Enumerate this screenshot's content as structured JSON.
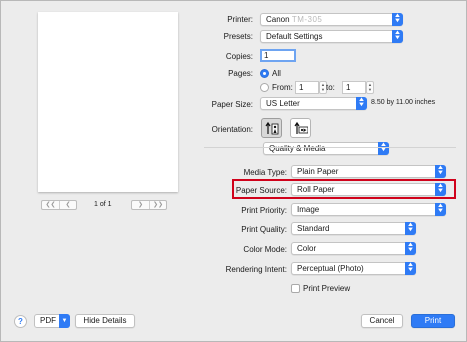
{
  "pager": {
    "text": "1 of 1",
    "first_icon": "double-left-arrow-icon",
    "prev_icon": "left-arrow-icon",
    "next_icon": "right-arrow-icon",
    "last_icon": "double-right-arrow-icon"
  },
  "printer": {
    "label": "Printer:",
    "value_prefix": "Canon",
    "value_model": "TM-305"
  },
  "presets": {
    "label": "Presets:",
    "value": "Default Settings"
  },
  "copies": {
    "label": "Copies:",
    "value": "1"
  },
  "pages": {
    "label": "Pages:",
    "all_label": "All",
    "from_label": "From:",
    "from_value": "1",
    "to_label": "to:",
    "to_value": "1",
    "selected": "All"
  },
  "paper_size": {
    "label": "Paper Size:",
    "value": "US Letter",
    "note": "8.50 by 11.00 inches"
  },
  "orientation": {
    "label": "Orientation:",
    "portrait_icon": "portrait-orientation-icon",
    "landscape_icon": "landscape-orientation-icon",
    "selected": "portrait"
  },
  "section": {
    "value": "Quality & Media"
  },
  "media_type": {
    "label": "Media Type:",
    "value": "Plain Paper"
  },
  "paper_source": {
    "label": "Paper Source:",
    "value": "Roll Paper"
  },
  "print_priority": {
    "label": "Print Priority:",
    "value": "Image"
  },
  "print_quality": {
    "label": "Print Quality:",
    "value": "Standard"
  },
  "color_mode": {
    "label": "Color Mode:",
    "value": "Color"
  },
  "rendering_intent": {
    "label": "Rendering Intent:",
    "value": "Perceptual (Photo)"
  },
  "print_preview": {
    "label": "Print Preview",
    "checked": false
  },
  "footer": {
    "help_label": "?",
    "pdf_label": "PDF",
    "hide_details_label": "Hide Details",
    "cancel_label": "Cancel",
    "print_label": "Print"
  },
  "colors": {
    "accent": "#2f7bf5",
    "highlight": "#d0021b",
    "dialog_bg": "#ececec"
  }
}
